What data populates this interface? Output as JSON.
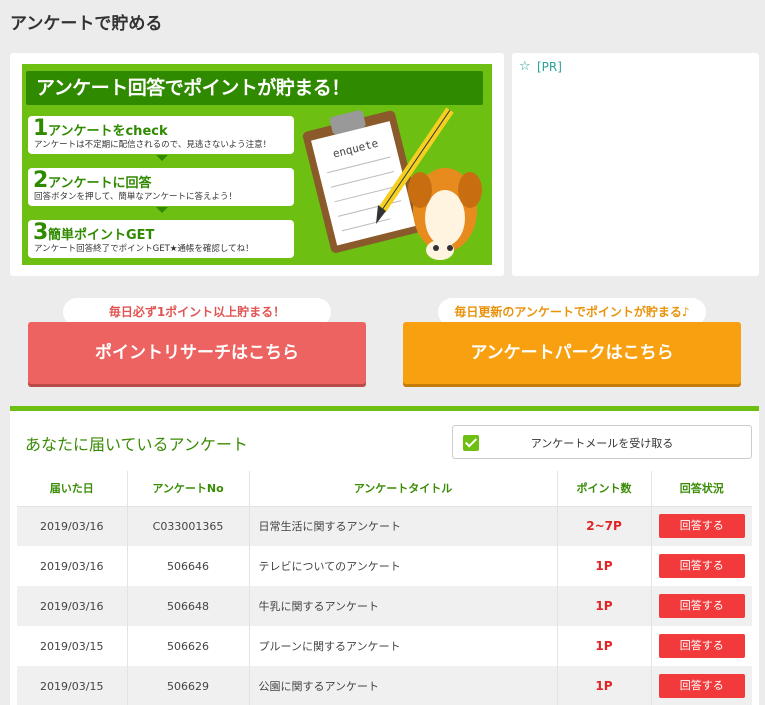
{
  "page": {
    "title": "アンケートで貯める"
  },
  "banner": {
    "headline": "アンケート回答でポイントが貯まる！",
    "steps": [
      {
        "num": "1",
        "title": "アンケートをcheck",
        "desc": "アンケートは不定期に配信されるので、見逃さないよう注意！"
      },
      {
        "num": "2",
        "title": "アンケートに回答",
        "desc": "回答ボタンを押して、簡単なアンケートに答えよう！"
      },
      {
        "num": "3",
        "title": "簡単ポイントGET",
        "desc": "アンケート回答終了でポイントGET★通帳を確認してね！"
      }
    ],
    "clipboard_text": "enquete"
  },
  "pr": {
    "star": "☆",
    "label": "[PR]"
  },
  "campaigns": [
    {
      "bubble": "毎日必ず1ポイント以上貯まる！",
      "button": "ポイントリサーチはこちら",
      "bubble_color": "#e05553"
    },
    {
      "bubble": "毎日更新のアンケートでポイントが貯まる♪",
      "button": "アンケートパークはこちら",
      "bubble_color": "#e9930c"
    }
  ],
  "survey": {
    "heading": "あなたに届いているアンケート",
    "mail_toggle_label": "アンケートメールを受け取る",
    "mail_toggle_checked": true,
    "columns": [
      "届いた日",
      "アンケートNo",
      "アンケートタイトル",
      "ポイント数",
      "回答状況"
    ],
    "rows": [
      {
        "date": "2019/03/16",
        "no": "C033001365",
        "title": "日常生活に関するアンケート",
        "points": "2~7P",
        "action": "回答する"
      },
      {
        "date": "2019/03/16",
        "no": "506646",
        "title": "テレビについてのアンケート",
        "points": "1P",
        "action": "回答する"
      },
      {
        "date": "2019/03/16",
        "no": "506648",
        "title": "牛乳に関するアンケート",
        "points": "1P",
        "action": "回答する"
      },
      {
        "date": "2019/03/15",
        "no": "506626",
        "title": "プルーンに関するアンケート",
        "points": "1P",
        "action": "回答する"
      },
      {
        "date": "2019/03/15",
        "no": "506629",
        "title": "公園に関するアンケート",
        "points": "1P",
        "action": "回答する"
      }
    ]
  },
  "colors": {
    "accent_green": "#6dc012",
    "heading_green": "#3a8c06",
    "red_button": "#ed6361",
    "orange_button": "#f9a011",
    "answer_button": "#f23a3c"
  }
}
